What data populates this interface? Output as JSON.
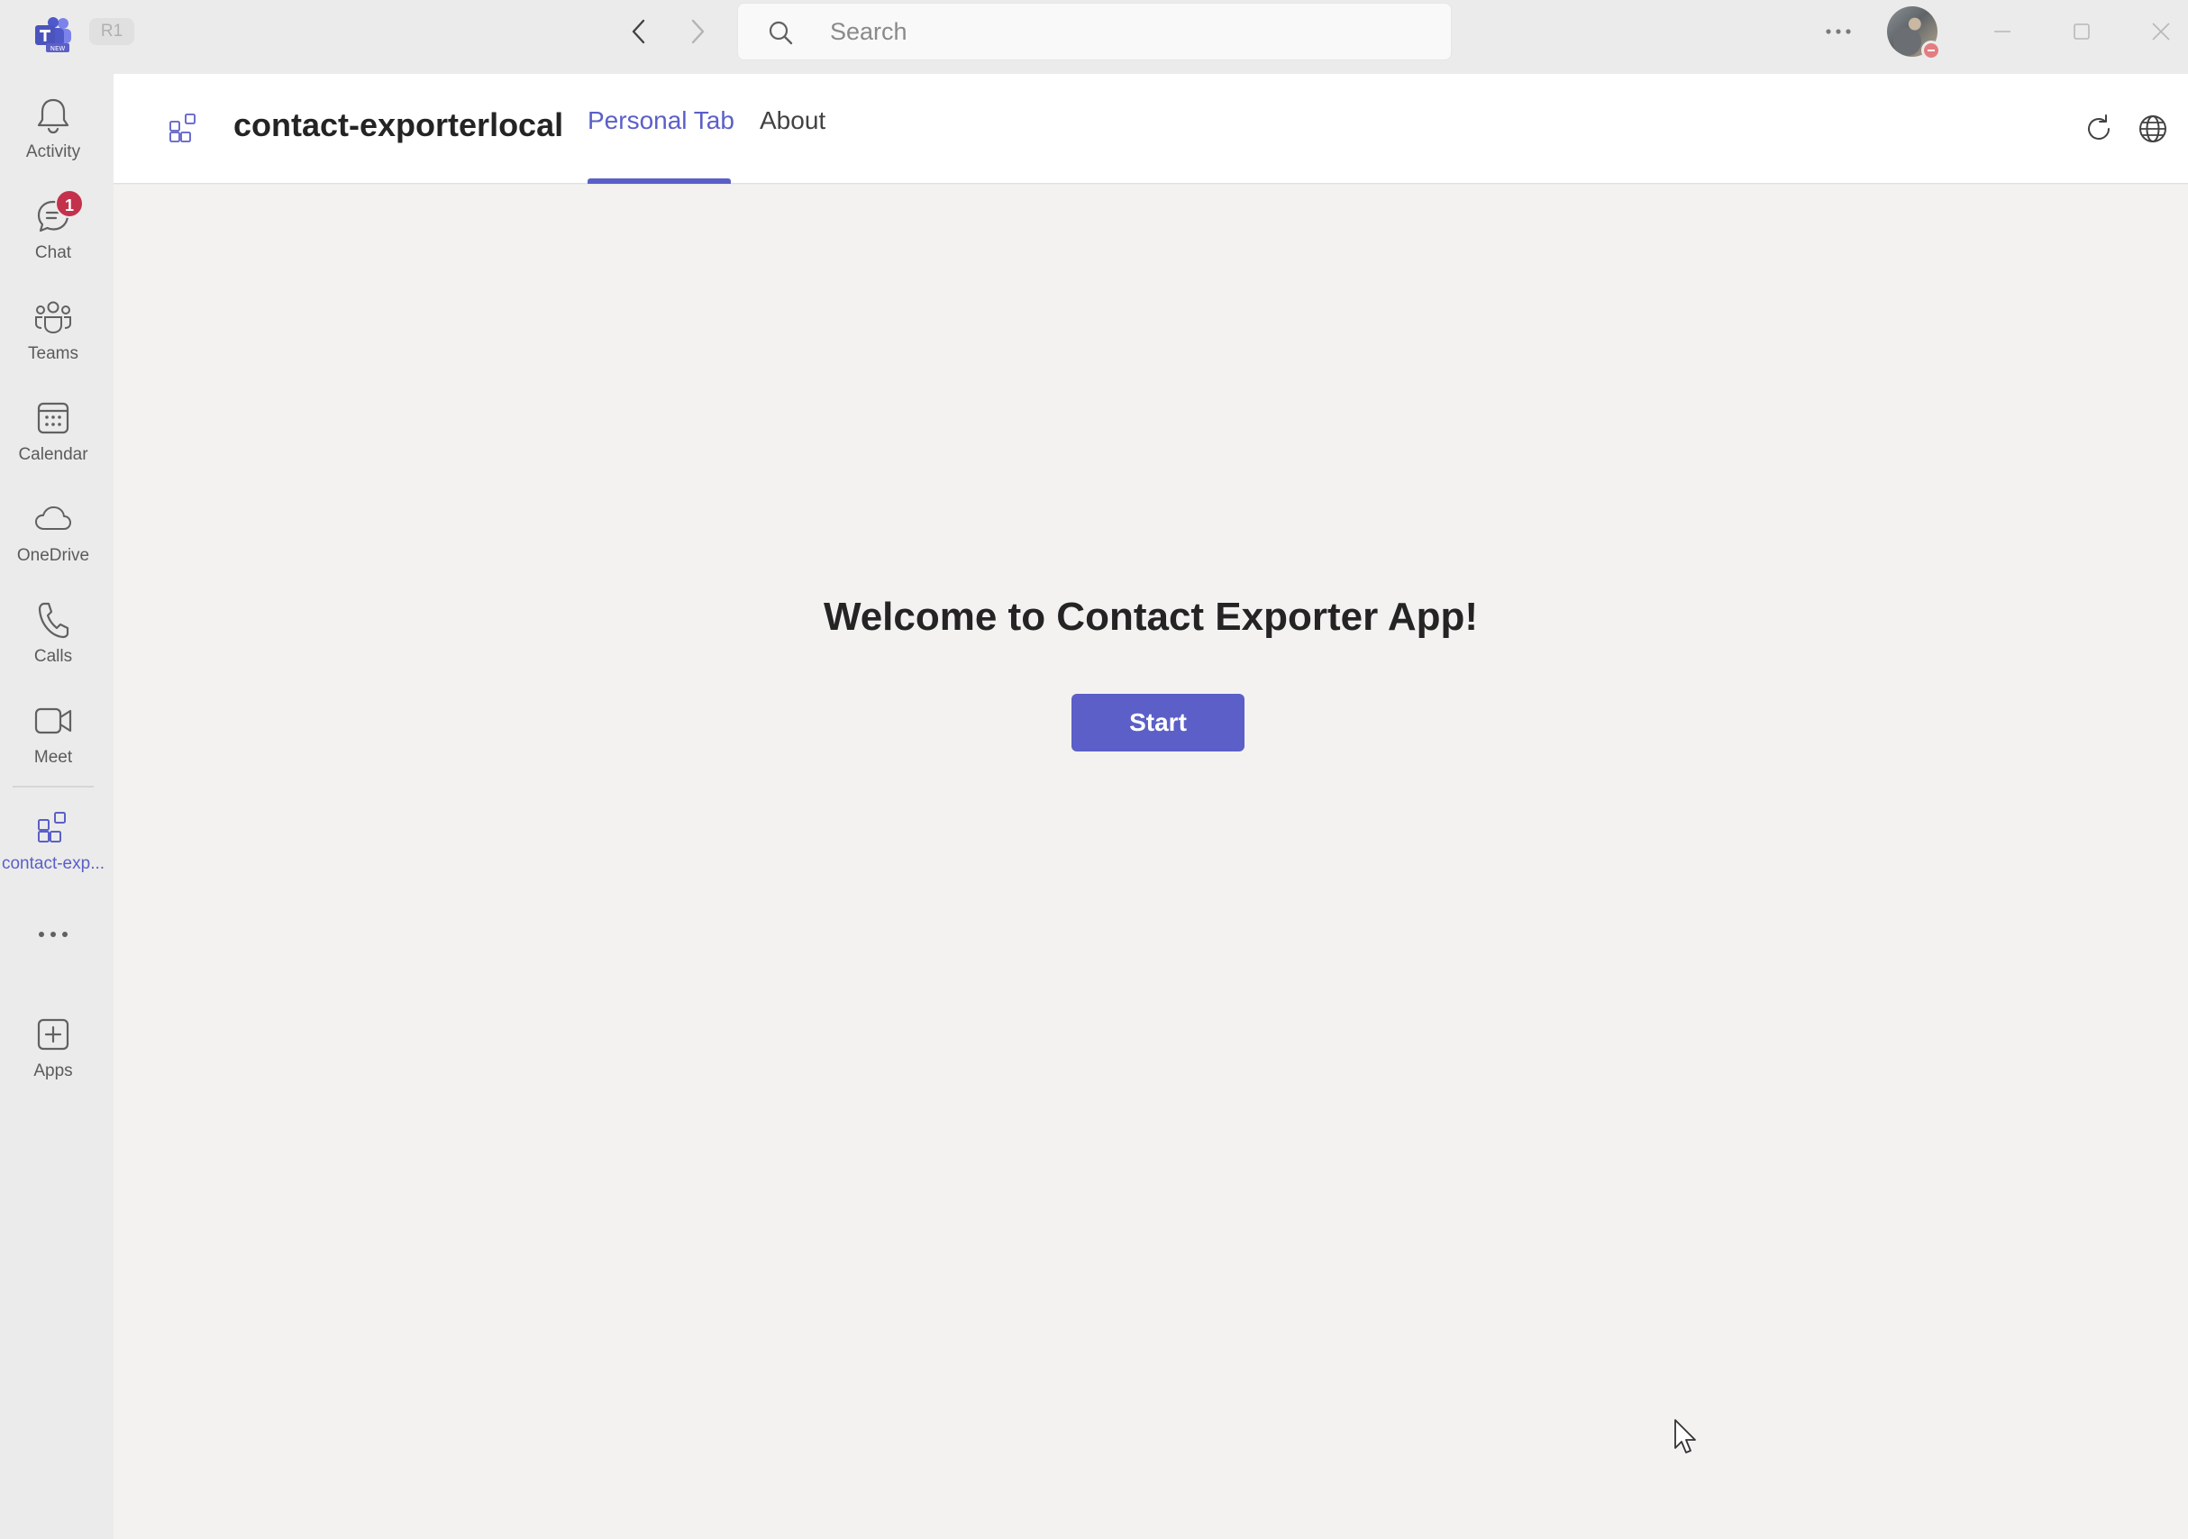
{
  "titlebar": {
    "env_badge": "R1",
    "search_placeholder": "Search",
    "logo_sub": "NEW"
  },
  "rail": {
    "items": [
      {
        "label": "Activity",
        "icon": "bell-icon"
      },
      {
        "label": "Chat",
        "icon": "chat-icon",
        "badge": "1"
      },
      {
        "label": "Teams",
        "icon": "teams-icon"
      },
      {
        "label": "Calendar",
        "icon": "calendar-icon"
      },
      {
        "label": "OneDrive",
        "icon": "cloud-icon"
      },
      {
        "label": "Calls",
        "icon": "phone-icon"
      },
      {
        "label": "Meet",
        "icon": "video-icon"
      },
      {
        "label": "contact-exp...",
        "icon": "app-grid-icon",
        "active": true
      },
      {
        "label": "Apps",
        "icon": "add-app-icon"
      }
    ]
  },
  "app": {
    "title": "contact-exporterlocal",
    "tabs": [
      {
        "label": "Personal Tab",
        "active": true
      },
      {
        "label": "About",
        "active": false
      }
    ]
  },
  "content": {
    "welcome": "Welcome to Contact Exporter App!",
    "start_label": "Start"
  },
  "colors": {
    "accent": "#5b5fc7",
    "badge": "#c4314b",
    "presence_dnd": "#e37d80",
    "content_bg": "#f3f2f1",
    "chrome_bg": "#ebebeb"
  }
}
